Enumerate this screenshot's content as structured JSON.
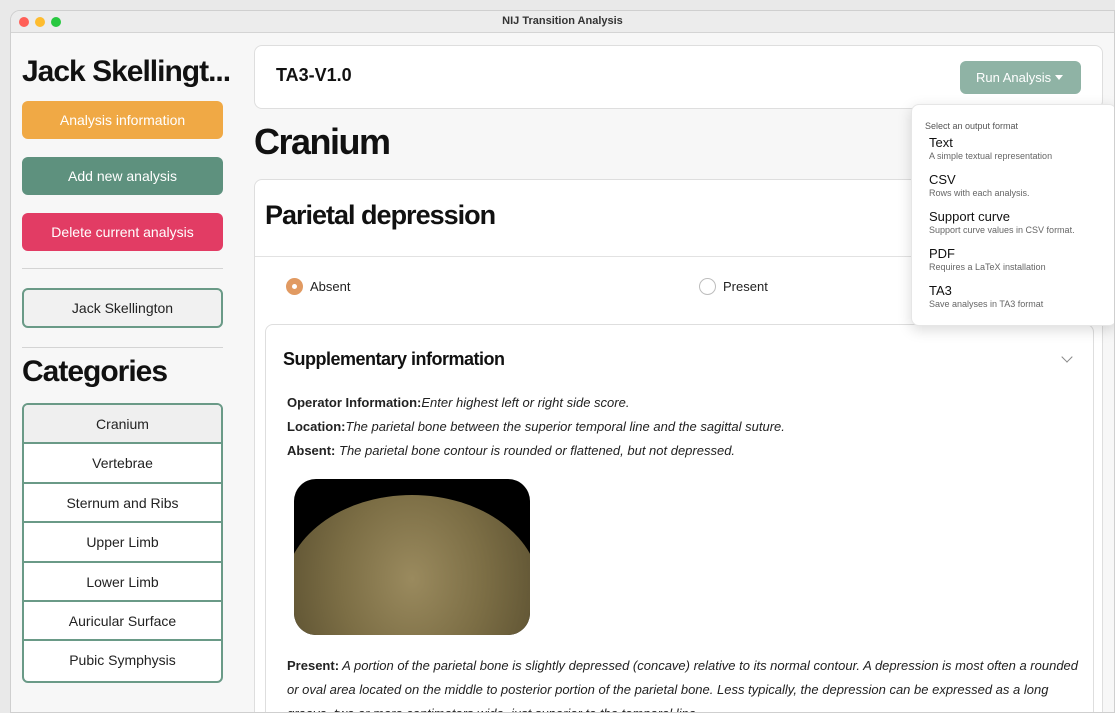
{
  "window": {
    "title": "NIJ Transition Analysis"
  },
  "sidebar": {
    "user_title": "Jack Skellingt...",
    "buttons": {
      "analysis_info": "Analysis information",
      "add_analysis": "Add new analysis",
      "delete_analysis": "Delete current analysis"
    },
    "current_user": "Jack Skellington",
    "categories_title": "Categories",
    "categories": [
      "Cranium",
      "Vertebrae",
      "Sternum and Ribs",
      "Upper Limb",
      "Lower Limb",
      "Auricular Surface",
      "Pubic Symphysis"
    ],
    "active_category": "Cranium"
  },
  "topbar": {
    "analysis_name": "TA3-V1.0",
    "run_button": "Run Analysis"
  },
  "main": {
    "page_title": "Cranium",
    "trait_title": "Parietal depression",
    "options": {
      "absent": "Absent",
      "present": "Present",
      "selected": "Absent"
    },
    "supplementary": {
      "title": "Supplementary information",
      "operator_label": "Operator Information:",
      "operator_text": "Enter highest left or right side score.",
      "location_label": "Location:",
      "location_text": "The parietal bone between the superior temporal line and the sagittal suture.",
      "absent_label": "Absent:",
      "absent_text": " The parietal bone contour is rounded or flattened, but not depressed.",
      "present_label": "Present:",
      "present_text": " A portion of the parietal bone is slightly depressed (concave) relative to its normal contour. A depression is most often a rounded or oval area located on the middle to posterior portion of the parietal bone. Less typically, the depression can be expressed as a long groove, two or more centimeters wide, just superior to the temporal line."
    }
  },
  "dropdown": {
    "header": "Select an output format",
    "items": [
      {
        "label": "Text",
        "desc": "A simple textual representation"
      },
      {
        "label": "CSV",
        "desc": "Rows with each analysis."
      },
      {
        "label": "Support curve",
        "desc": "Support curve values in CSV format."
      },
      {
        "label": "PDF",
        "desc": "Requires a LaTeX installation"
      },
      {
        "label": "TA3",
        "desc": "Save analyses in TA3 format"
      }
    ]
  },
  "colors": {
    "info_button": "#f0a945",
    "add_button": "#5e917e",
    "delete_button": "#e23c64",
    "run_button": "#8fb3a5",
    "radio_checked": "#e19a62"
  },
  "icons": {
    "dropdown_caret": "caret-down-icon",
    "collapse": "chevron-down-icon"
  }
}
